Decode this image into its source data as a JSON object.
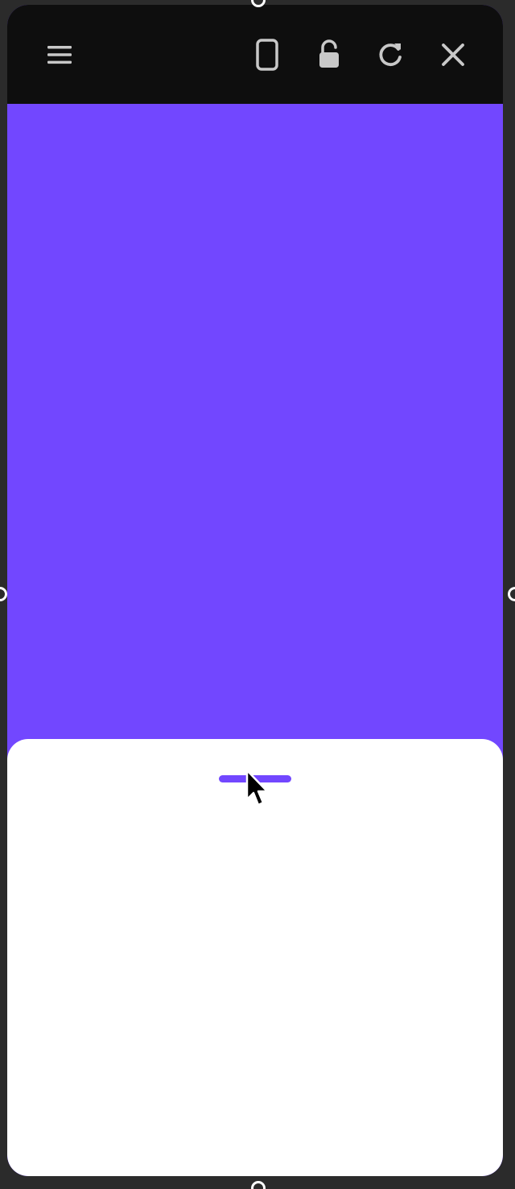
{
  "window": {
    "background_color": "#7247ff",
    "toolbar_color": "#0e0e0e",
    "sheet_color": "#ffffff",
    "frame_color": "#2b2b2b"
  },
  "toolbar": {
    "icons": {
      "menu": "menu-icon",
      "device": "phone-icon",
      "lock": "unlock-icon",
      "rotate": "rotate-icon",
      "close": "close-icon"
    },
    "icon_color": "#c8c8c8"
  },
  "sheet": {
    "handle_color": "#7247ff"
  }
}
